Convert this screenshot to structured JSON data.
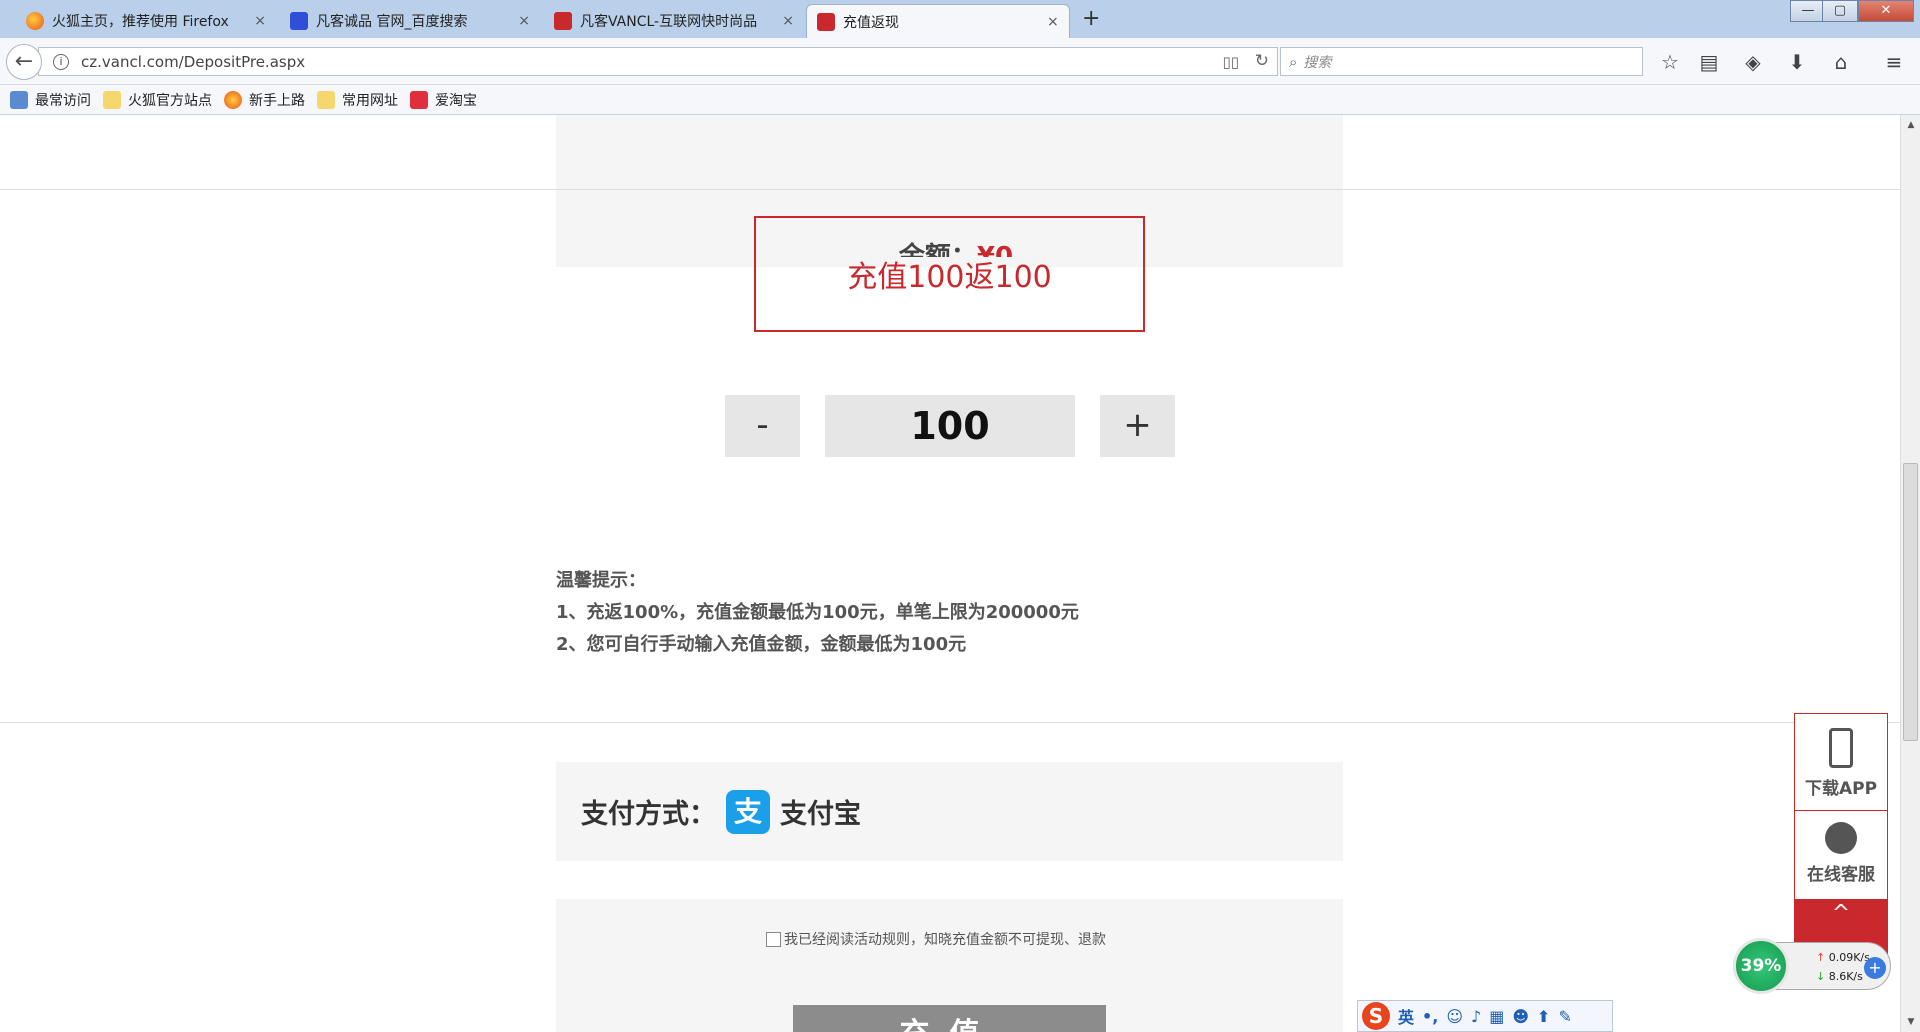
{
  "browser": {
    "tabs": [
      {
        "title": "火狐主页，推荐使用 Firefox",
        "icon": "firefox-icon",
        "close": "×"
      },
      {
        "title": "凡客诚品 官网_百度搜索",
        "icon": "baidu-icon",
        "close": "×"
      },
      {
        "title": "凡客VANCL-互联网快时尚品",
        "icon": "vancl-icon",
        "close": "×"
      },
      {
        "title": "充值返现",
        "icon": "vancl-icon",
        "close": "×"
      }
    ],
    "new_tab": "+",
    "window_buttons": {
      "minimize": "—",
      "maximize": "▢",
      "close": "✕"
    },
    "url": "cz.vancl.com/DepositPre.aspx",
    "search_placeholder": "搜索",
    "bookmarks": [
      {
        "label": "最常访问",
        "icon": "frequent-icon"
      },
      {
        "label": "火狐官方站点",
        "icon": "folder-icon"
      },
      {
        "label": "新手上路",
        "icon": "firefox-icon"
      },
      {
        "label": "常用网址",
        "icon": "folder-icon"
      },
      {
        "label": "爱淘宝",
        "icon": "taobao-icon"
      }
    ],
    "toolbar_icons": [
      "star-icon",
      "reading-list-icon",
      "pocket-icon",
      "download-icon",
      "home-icon",
      "menu-icon"
    ]
  },
  "page": {
    "balance_label": "余额：",
    "balance_amount": "¥0",
    "promo_text": "充值100返100",
    "stepper": {
      "minus": "-",
      "value": "100",
      "plus": "+"
    },
    "tips": {
      "title": "温馨提示：",
      "line1": "1、充返100%，充值金额最低为100元，单笔上限为200000元",
      "line2": "2、您可自行手动输入充值金额，金额最低为100元"
    },
    "payment": {
      "label": "支付方式：",
      "method_icon": "支",
      "method": "支付宝"
    },
    "agreement": "我已经阅读活动规则，知晓充值金额不可提现、退款",
    "submit": "充值"
  },
  "float_tools": {
    "download_app": "下载APP",
    "customer_service": "在线客服",
    "back_to_top": "^"
  },
  "overlays": {
    "net_percent": "39%",
    "net_up": "0.09K/s",
    "net_down": "8.6K/s",
    "ime_logo": "S",
    "ime_lang": "英"
  },
  "colors": {
    "accent": "#c9282d",
    "alipay": "#1a9fe8",
    "tab_bg": "#b9cfea"
  }
}
